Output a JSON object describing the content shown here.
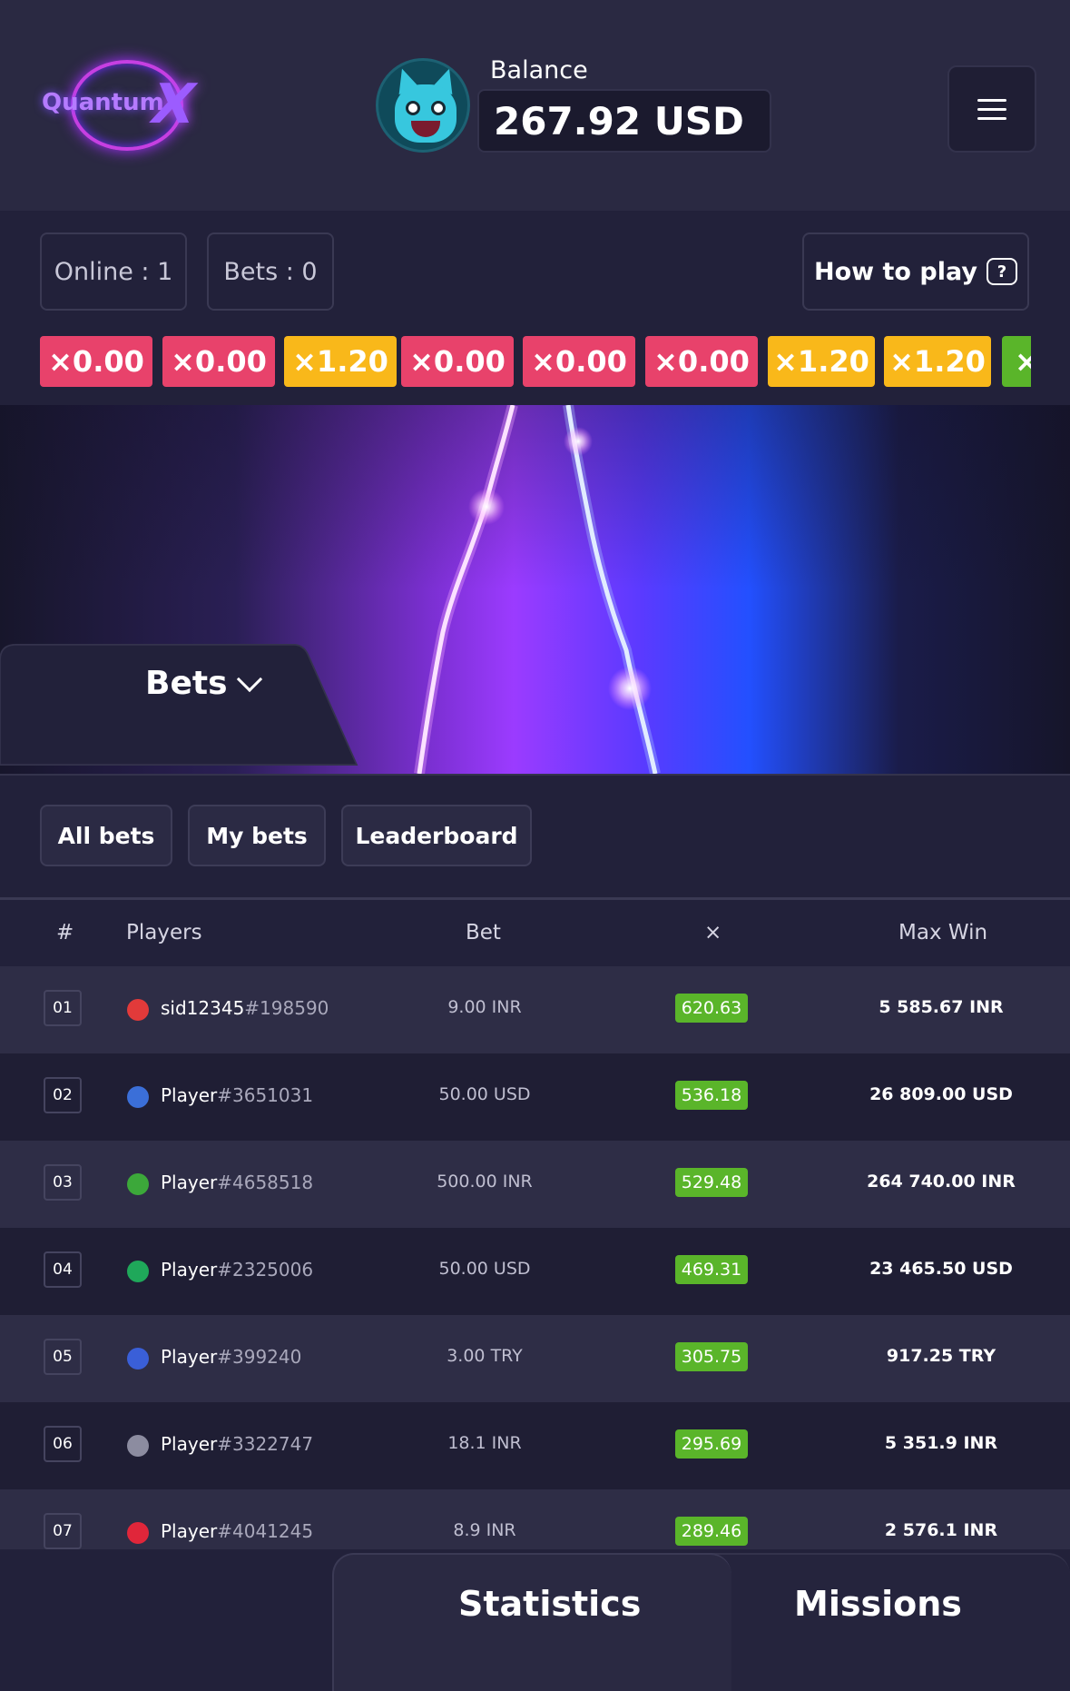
{
  "header": {
    "logo_text": "Quantum",
    "logo_x": "X",
    "balance_label": "Balance",
    "balance_value": "267.92 USD"
  },
  "stats": {
    "online": "Online : 1",
    "bets": "Bets : 0",
    "how_to_play": "How to play",
    "help_glyph": "?"
  },
  "multipliers": [
    {
      "label": "×0.00",
      "color": "#e8426b"
    },
    {
      "label": "×0.00",
      "color": "#e8426b"
    },
    {
      "label": "×1.20",
      "color": "#f9b81a"
    },
    {
      "label": "×0.00",
      "color": "#e8426b"
    },
    {
      "label": "×0.00",
      "color": "#e8426b"
    },
    {
      "label": "×0.00",
      "color": "#e8426b"
    },
    {
      "label": "×1.20",
      "color": "#f9b81a"
    },
    {
      "label": "×1.20",
      "color": "#f9b81a"
    },
    {
      "label": "×",
      "color": "#5ab52a"
    }
  ],
  "bets_panel": {
    "title": "Bets"
  },
  "tabs": {
    "all_bets": "All bets",
    "my_bets": "My bets",
    "leaderboard": "Leaderboard"
  },
  "table": {
    "headers": {
      "rank": "#",
      "players": "Players",
      "bet": "Bet",
      "mult": "×",
      "max_win": "Max Win"
    },
    "rows": [
      {
        "rank": "01",
        "name": "sid12345",
        "tag": "#198590",
        "bet": "9.00 INR",
        "mult": "620.63",
        "win": "5 585.67 INR",
        "icon": "mushroom-icon",
        "icon_color": "#e23a3a"
      },
      {
        "rank": "02",
        "name": "Player",
        "tag": "#3651031",
        "bet": "50.00 USD",
        "mult": "536.18",
        "win": "26 809.00 USD",
        "icon": "astronaut-icon",
        "icon_color": "#3b6fd8"
      },
      {
        "rank": "03",
        "name": "Player",
        "tag": "#4658518",
        "bet": "500.00 INR",
        "mult": "529.48",
        "win": "264 740.00 INR",
        "icon": "alien-icon",
        "icon_color": "#3ca83a"
      },
      {
        "rank": "04",
        "name": "Player",
        "tag": "#2325006",
        "bet": "50.00 USD",
        "mult": "469.31",
        "win": "23 465.50 USD",
        "icon": "gem-icon",
        "icon_color": "#1fa85a"
      },
      {
        "rank": "05",
        "name": "Player",
        "tag": "#399240",
        "bet": "3.00 TRY",
        "mult": "305.75",
        "win": "917.25 TRY",
        "icon": "rocket-icon",
        "icon_color": "#3a5fd8"
      },
      {
        "rank": "06",
        "name": "Player",
        "tag": "#3322747",
        "bet": "18.1 INR",
        "mult": "295.69",
        "win": "5 351.9 INR",
        "icon": "ninja-icon",
        "icon_color": "#8c8ca0"
      },
      {
        "rank": "07",
        "name": "Player",
        "tag": "#4041245",
        "bet": "8.9 INR",
        "mult": "289.46",
        "win": "2 576.1 INR",
        "icon": "dragon-icon",
        "icon_color": "#e0263a"
      }
    ]
  },
  "bottom_tabs": {
    "statistics": "Statistics",
    "missions": "Missions"
  },
  "colors": {
    "accent_green": "#5ab52a",
    "loss_red": "#e8426b",
    "mid_yellow": "#f9b81a"
  }
}
